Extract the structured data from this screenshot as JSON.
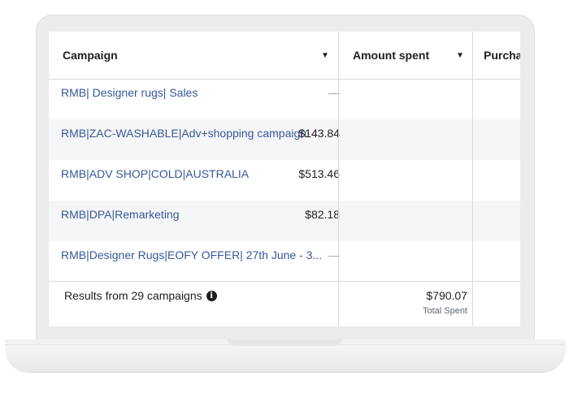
{
  "table": {
    "columns": [
      {
        "label": "Campaign",
        "sortable": true
      },
      {
        "label": "Amount spent",
        "sortable": true
      },
      {
        "label": "Purcha",
        "sortable": false
      }
    ],
    "rows": [
      {
        "campaign": "RMB| Designer rugs| Sales",
        "amount": "—"
      },
      {
        "campaign": "RMB|ZAC-WASHABLE|Adv+shopping campaign",
        "amount": "$143.84"
      },
      {
        "campaign": "RMB|ADV SHOP|COLD|AUSTRALIA",
        "amount": "$513.46"
      },
      {
        "campaign": "RMB|DPA|Remarketing",
        "amount": "$82.18"
      },
      {
        "campaign": "RMB|Designer Rugs|EOFY OFFER| 27th June - 3...",
        "amount": "—"
      }
    ],
    "footer": {
      "label": "Results from 29 campaigns",
      "total": "$790.07",
      "total_caption": "Total Spent"
    }
  },
  "icons": {
    "sort": "chevron-down-icon",
    "info": "info-icon"
  }
}
